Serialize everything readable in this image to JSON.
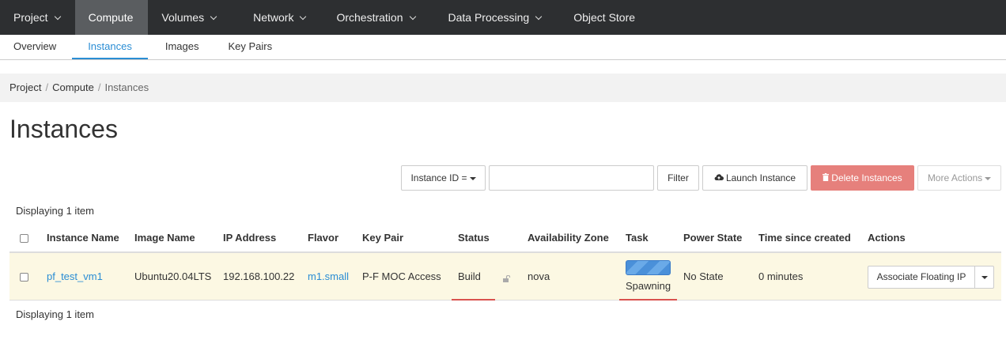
{
  "topnav": {
    "items": [
      {
        "label": "Project",
        "has_caret": true
      },
      {
        "label": "Compute",
        "has_caret": false,
        "active": true
      },
      {
        "label": "Volumes",
        "has_caret": true
      },
      {
        "label": "Network",
        "has_caret": true
      },
      {
        "label": "Orchestration",
        "has_caret": true
      },
      {
        "label": "Data Processing",
        "has_caret": true
      },
      {
        "label": "Object Store",
        "has_caret": false
      }
    ]
  },
  "subnav": {
    "items": [
      "Overview",
      "Instances",
      "Images",
      "Key Pairs"
    ],
    "active": "Instances"
  },
  "breadcrumb": {
    "items": [
      "Project",
      "Compute"
    ],
    "current": "Instances",
    "separator": "/"
  },
  "page": {
    "title": "Instances"
  },
  "toolbar": {
    "filter_field_label": "Instance ID =",
    "filter_value": "",
    "filter_button": "Filter",
    "launch_button": "Launch Instance",
    "launch_icon": "cloud-upload-icon",
    "delete_button": "Delete Instances",
    "delete_icon": "trash-icon",
    "more_actions": "More Actions"
  },
  "table": {
    "count_top": "Displaying 1 item",
    "count_bottom": "Displaying 1 item",
    "headers": [
      "Instance Name",
      "Image Name",
      "IP Address",
      "Flavor",
      "Key Pair",
      "Status",
      "Availability Zone",
      "Task",
      "Power State",
      "Time since created",
      "Actions"
    ],
    "rows": [
      {
        "instance_name": "pf_test_vm1",
        "image_name": "Ubuntu20.04LTS",
        "ip_address": "192.168.100.22",
        "flavor": "m1.small",
        "key_pair": "P-F MOC Access",
        "status": "Build",
        "availability_zone": "nova",
        "task": "Spawning",
        "power_state": "No State",
        "time_since_created": "0 minutes",
        "action_primary": "Associate Floating IP"
      }
    ]
  },
  "colors": {
    "topnav_bg": "#2d2f31",
    "accent": "#2a8dd4",
    "danger": "#e6807c",
    "row_highlight": "#fcf8e3"
  }
}
